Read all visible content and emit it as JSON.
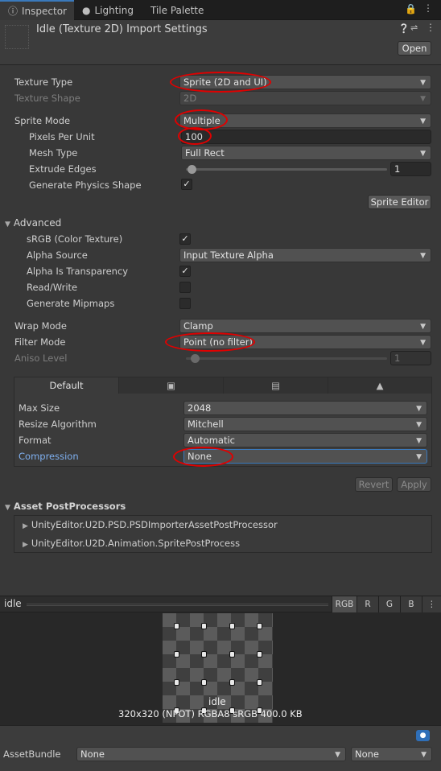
{
  "tabs": [
    {
      "label": "Inspector",
      "icon": "info-icon"
    },
    {
      "label": "Lighting",
      "icon": "bulb-icon"
    },
    {
      "label": "Tile Palette",
      "icon": ""
    }
  ],
  "header": {
    "title": "Idle (Texture 2D) Import Settings",
    "open_label": "Open"
  },
  "texture": {
    "type_label": "Texture Type",
    "type_value": "Sprite (2D and UI)",
    "shape_label": "Texture Shape",
    "shape_value": "2D",
    "sprite_mode_label": "Sprite Mode",
    "sprite_mode_value": "Multiple",
    "ppu_label": "Pixels Per Unit",
    "ppu_value": "100",
    "mesh_label": "Mesh Type",
    "mesh_value": "Full Rect",
    "extrude_label": "Extrude Edges",
    "extrude_value": "1",
    "physics_label": "Generate Physics Shape",
    "physics_checked": true,
    "sprite_editor_label": "Sprite Editor"
  },
  "advanced": {
    "title": "Advanced",
    "srgb_label": "sRGB (Color Texture)",
    "srgb_checked": true,
    "alpha_source_label": "Alpha Source",
    "alpha_source_value": "Input Texture Alpha",
    "alpha_transp_label": "Alpha Is Transparency",
    "alpha_transp_checked": true,
    "readwrite_label": "Read/Write",
    "readwrite_checked": false,
    "mipmaps_label": "Generate Mipmaps",
    "mipmaps_checked": false
  },
  "sampling": {
    "wrap_label": "Wrap Mode",
    "wrap_value": "Clamp",
    "filter_label": "Filter Mode",
    "filter_value": "Point (no filter)",
    "aniso_label": "Aniso Level",
    "aniso_value": "1"
  },
  "platform": {
    "tabs": [
      {
        "label": "Default",
        "icon": ""
      },
      {
        "label": "",
        "icon": "monitor-icon"
      },
      {
        "label": "",
        "icon": "server-icon"
      },
      {
        "label": "",
        "icon": "android-icon"
      }
    ],
    "max_size_label": "Max Size",
    "max_size_value": "2048",
    "resize_label": "Resize Algorithm",
    "resize_value": "Mitchell",
    "format_label": "Format",
    "format_value": "Automatic",
    "compression_label": "Compression",
    "compression_value": "None"
  },
  "actions": {
    "revert": "Revert",
    "apply": "Apply"
  },
  "postprocessors": {
    "title": "Asset PostProcessors",
    "items": [
      "UnityEditor.U2D.PSD.PSDImporterAssetPostProcessor",
      "UnityEditor.U2D.Animation.SpritePostProcess"
    ]
  },
  "preview": {
    "name": "idle",
    "channels": [
      "RGB",
      "R",
      "G",
      "B"
    ],
    "label_name": "idle",
    "info": "320x320 (NPOT)  RGBA8 sRGB  400.0 KB"
  },
  "assetbundle": {
    "label": "AssetBundle",
    "name_value": "None",
    "variant_value": "None"
  },
  "colors": {
    "accent": "#3a79bb",
    "annotation": "#e00000",
    "link_label": "#7fb0f0"
  }
}
